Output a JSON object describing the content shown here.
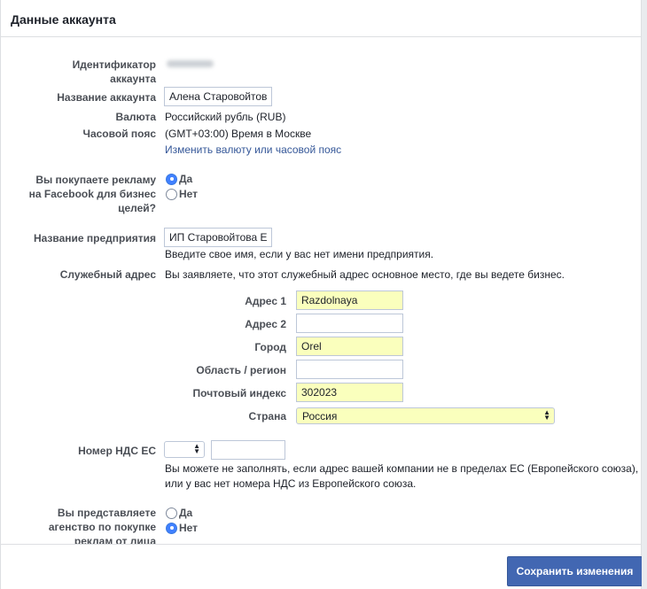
{
  "header": {
    "title": "Данные аккаунта"
  },
  "account": {
    "id_label": "Идентификатор аккаунта",
    "name_label": "Название аккаунта",
    "name_value": "Алена Старовойтова",
    "currency_label": "Валюта",
    "currency_value": "Российский рубль (RUB)",
    "timezone_label": "Часовой пояс",
    "timezone_value": "(GMT+03:00) Время в Москве",
    "change_link": "Изменить валюту или часовой пояс"
  },
  "business_use": {
    "label": "Вы покупаете рекламу на Facebook для бизнес целей?",
    "options": [
      "Да",
      "Нет"
    ],
    "selected": "Да"
  },
  "company": {
    "label": "Название предприятия",
    "value": "ИП Старовойтова Еле",
    "hint": "Введите свое имя, если у вас нет имени предприятия."
  },
  "address": {
    "label": "Служебный адрес",
    "description": "Вы заявляете, что этот служебный адрес основное место, где вы ведете бизнес.",
    "address1_label": "Адрес 1",
    "address1_value": "Razdolnaya",
    "address2_label": "Адрес 2",
    "address2_value": "",
    "city_label": "Город",
    "city_value": "Orel",
    "region_label": "Область / регион",
    "region_value": "",
    "postal_label": "Почтовый индекс",
    "postal_value": "302023",
    "country_label": "Страна",
    "country_value": "Россия"
  },
  "vat": {
    "label": "Номер НДС ЕС",
    "country_value": "",
    "number_value": "",
    "hint_line1": "Вы можете не заполнять, если адрес вашей компании не в пределах ЕС (Европейского союза),",
    "hint_line2": "или у вас нет номера НДС из Европейского союза."
  },
  "agency": {
    "label": "Вы представляете агенство по покупке реклам от лица",
    "options": [
      "Да",
      "Нет"
    ],
    "selected": "Нет"
  },
  "footer": {
    "save_label": "Сохранить изменения"
  },
  "colors": {
    "primary": "#4267b2",
    "link": "#365899",
    "autofill": "#faffbd"
  }
}
